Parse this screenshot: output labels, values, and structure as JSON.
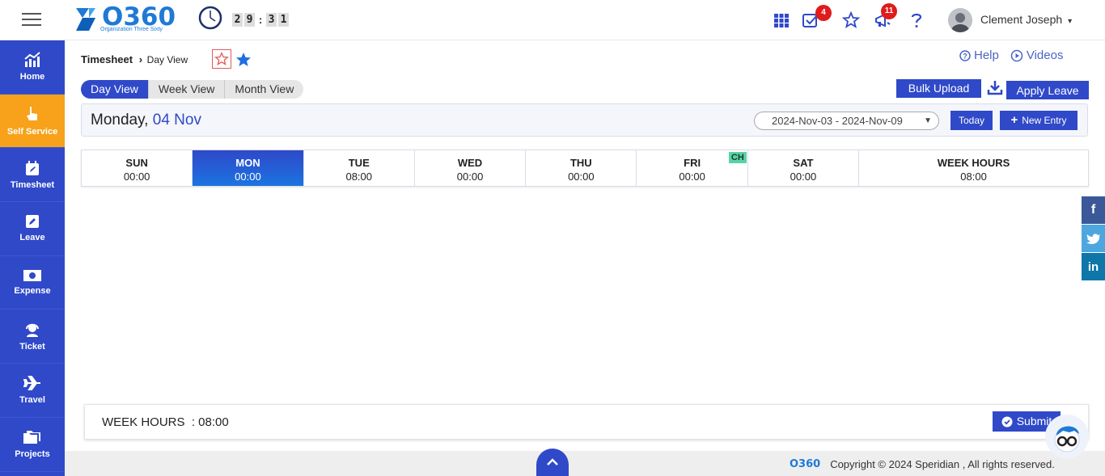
{
  "header": {
    "logo_text": "O360",
    "logo_sub": "Organization Three Sixty",
    "timer_digits": [
      "2",
      "9",
      "3",
      "1"
    ],
    "timer_sep": ":",
    "tasks_badge": "4",
    "announce_badge": "11",
    "user_name": "Clement Joseph",
    "user_caret": "▾"
  },
  "sidebar": {
    "items": [
      {
        "label": "Home",
        "icon": "chart-icon"
      },
      {
        "label": "Self Service",
        "icon": "hand-pointer-icon"
      },
      {
        "label": "Timesheet",
        "icon": "calendar-edit-icon"
      },
      {
        "label": "Leave",
        "icon": "pencil-square-icon"
      },
      {
        "label": "Expense",
        "icon": "money-icon"
      },
      {
        "label": "Ticket",
        "icon": "headset-icon"
      },
      {
        "label": "Travel",
        "icon": "plane-icon"
      },
      {
        "label": "Projects",
        "icon": "folders-icon"
      }
    ]
  },
  "breadcrumb": {
    "parent": "Timesheet",
    "separator": "›",
    "current": "Day View"
  },
  "help": {
    "help_label": "Help",
    "videos_label": "Videos"
  },
  "views": {
    "tabs": [
      "Day View",
      "Week View",
      "Month View"
    ],
    "active": "Day View"
  },
  "actions": {
    "bulk_upload": "Bulk Upload",
    "apply_leave": "Apply Leave"
  },
  "date_bar": {
    "weekday": "Monday,",
    "date": "04 Nov",
    "range": "2024-Nov-03 - 2024-Nov-09",
    "today": "Today",
    "new_entry": "New Entry"
  },
  "days": [
    {
      "name": "SUN",
      "hours": "00:00"
    },
    {
      "name": "MON",
      "hours": "00:00"
    },
    {
      "name": "TUE",
      "hours": "08:00"
    },
    {
      "name": "WED",
      "hours": "00:00"
    },
    {
      "name": "THU",
      "hours": "00:00"
    },
    {
      "name": "FRI",
      "hours": "00:00",
      "tag": "CH"
    },
    {
      "name": "SAT",
      "hours": "00:00"
    }
  ],
  "week_hours": {
    "name": "WEEK HOURS",
    "hours": "08:00"
  },
  "summary": {
    "label": "WEEK HOURS  : 08:00",
    "submit": "Submit"
  },
  "footer": {
    "logo": "O360",
    "copyright": "Copyright © 2024 Speridian , All rights reserved."
  },
  "colors": {
    "primary": "#2f49c9",
    "accent": "#f7a21a",
    "logo": "#1f79d6",
    "badge": "#e01b1b",
    "holiday": "#58d3a5"
  }
}
